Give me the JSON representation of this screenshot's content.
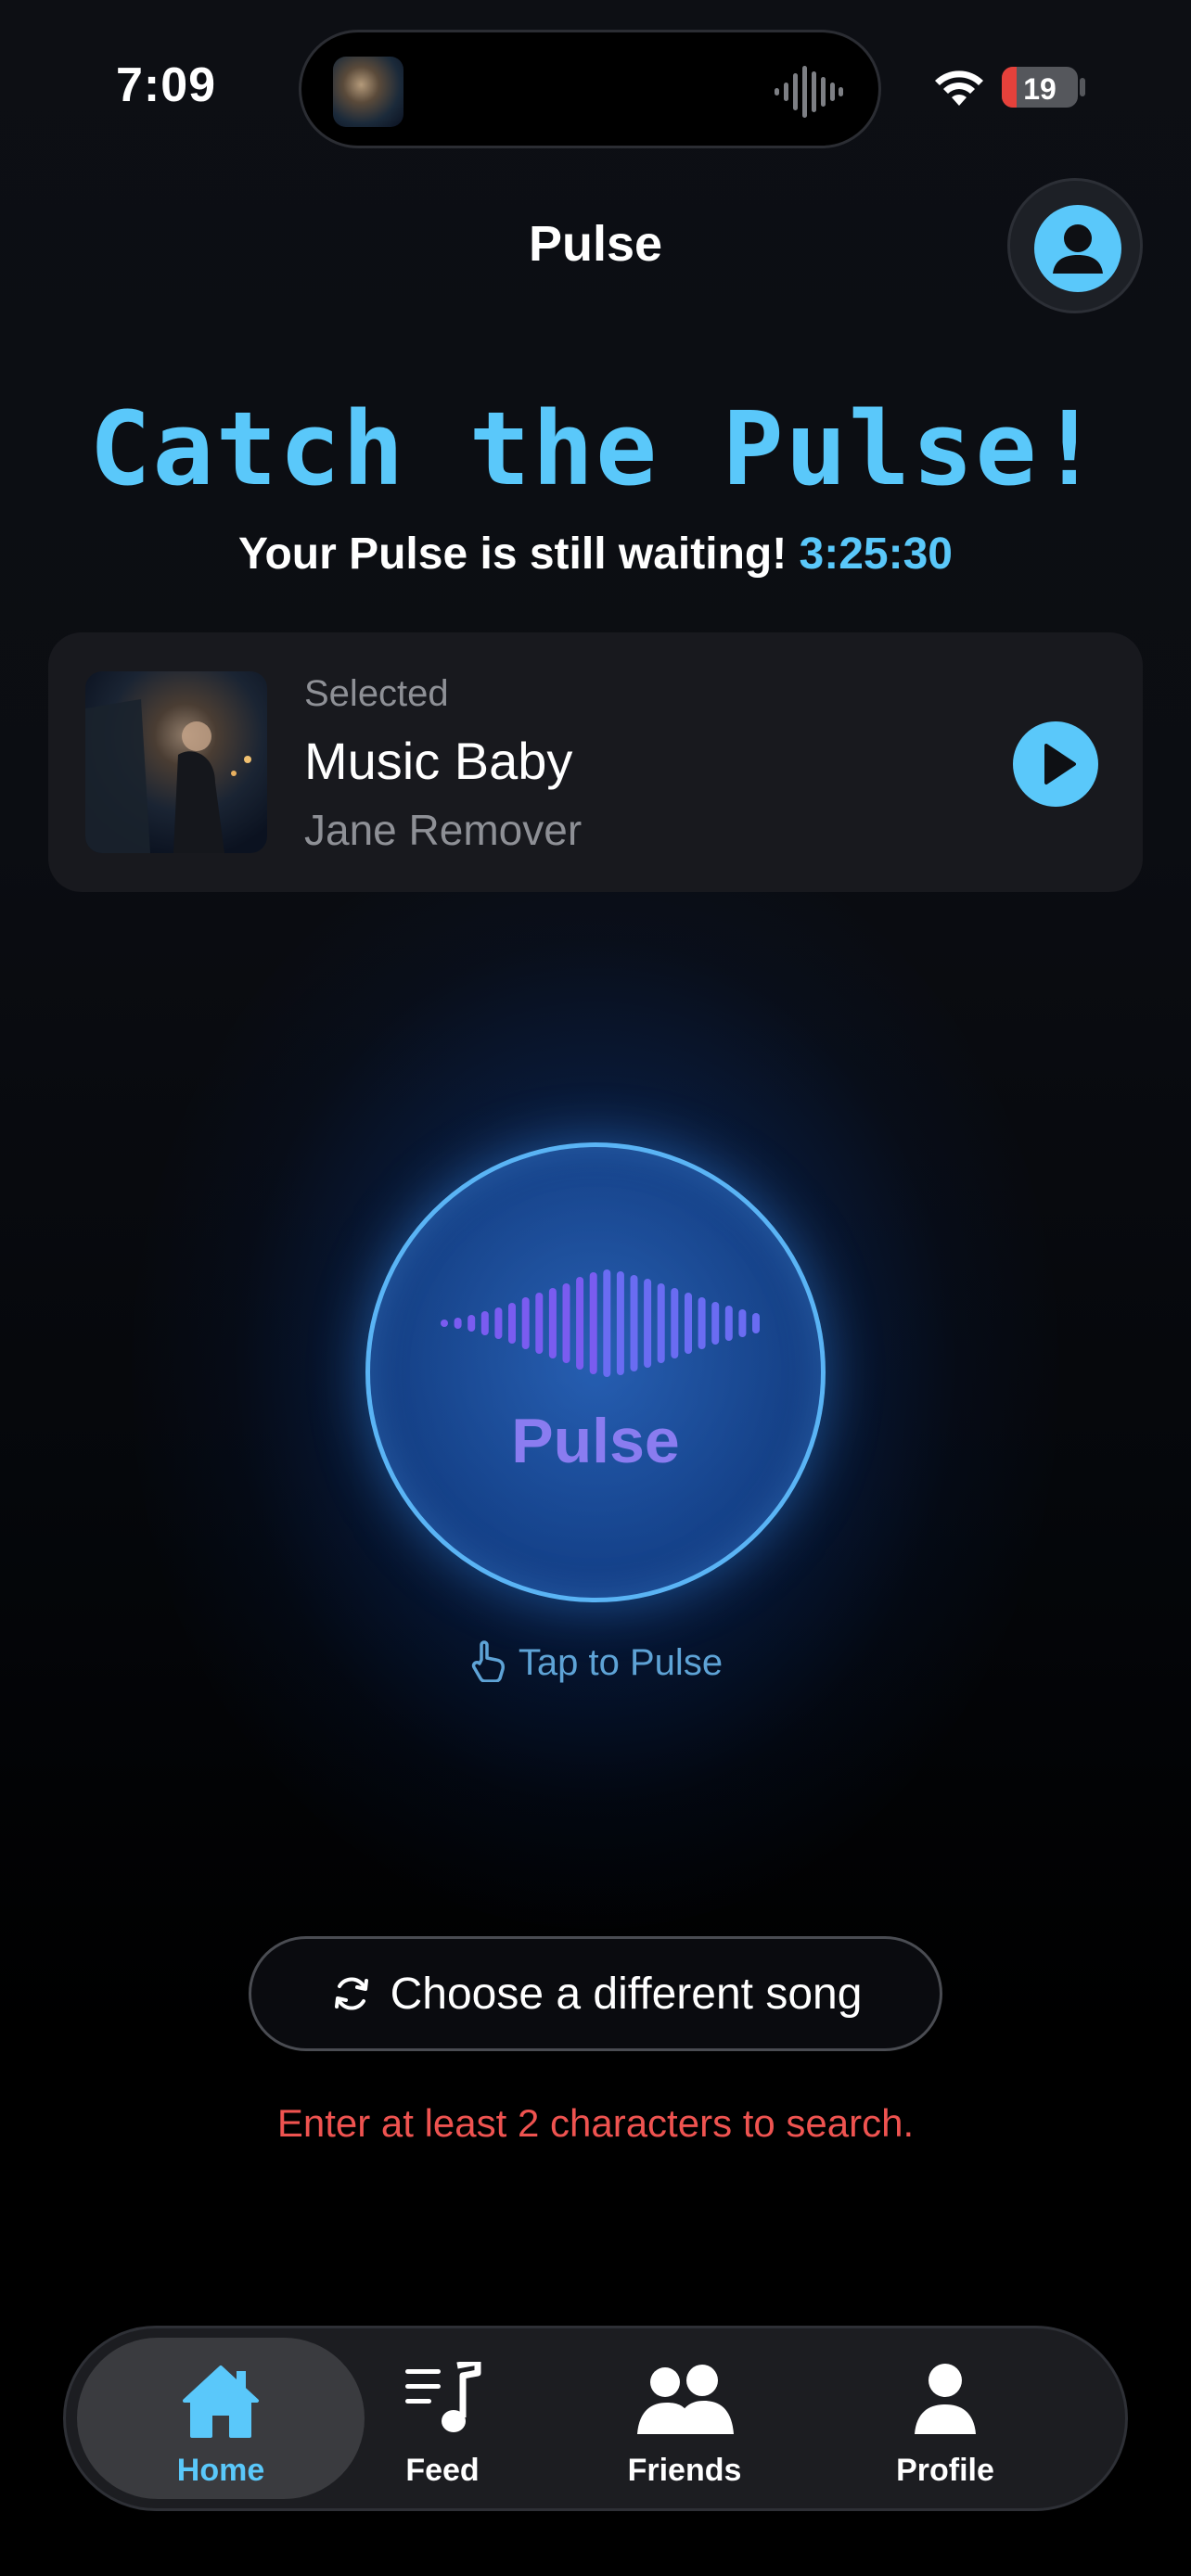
{
  "status_bar": {
    "time": "7:09",
    "battery": "19",
    "battery_level": 0.19
  },
  "header": {
    "title": "Pulse"
  },
  "hero": {
    "headline": "Catch the Pulse!",
    "subline": "Your Pulse is still waiting!",
    "timer": "3:25:30"
  },
  "selected_song": {
    "label": "Selected",
    "title": "Music Baby",
    "artist": "Jane Remover"
  },
  "pulse_button": {
    "label": "Pulse"
  },
  "tap_hint": "Tap to Pulse",
  "choose_button": {
    "label": "Choose a different song"
  },
  "error_message": "Enter at least 2 characters to search.",
  "tab_bar": {
    "active": "Home",
    "items": [
      {
        "label": "Home",
        "icon": "home-icon"
      },
      {
        "label": "Feed",
        "icon": "feed-icon"
      },
      {
        "label": "Friends",
        "icon": "friends-icon"
      },
      {
        "label": "Profile",
        "icon": "profile-icon"
      }
    ]
  },
  "colors": {
    "accent": "#5ac8fa",
    "pulse_purple": "#8a7cf0",
    "error": "#ef5350",
    "background": "#0b0d12"
  }
}
